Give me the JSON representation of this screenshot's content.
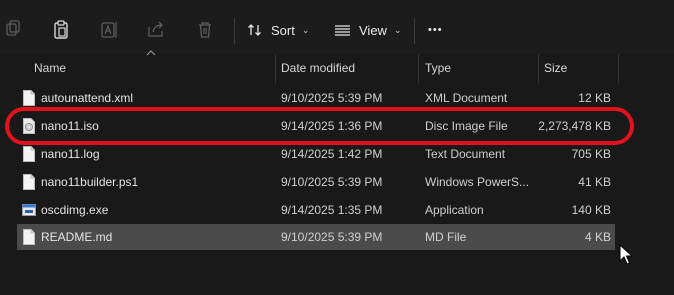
{
  "toolbar": {
    "sort_label": "Sort",
    "view_label": "View",
    "more_label": "•••"
  },
  "columns": {
    "name": "Name",
    "date": "Date modified",
    "type": "Type",
    "size": "Size"
  },
  "files": [
    {
      "name": "autounattend.xml",
      "date": "9/10/2025 5:39 PM",
      "type": "XML Document",
      "size": "12 KB",
      "icon": "xml-file-icon"
    },
    {
      "name": "nano11.iso",
      "date": "9/14/2025 1:36 PM",
      "type": "Disc Image File",
      "size": "2,273,478 KB",
      "icon": "disc-image-icon"
    },
    {
      "name": "nano11.log",
      "date": "9/14/2025 1:42 PM",
      "type": "Text Document",
      "size": "705 KB",
      "icon": "text-file-icon"
    },
    {
      "name": "nano11builder.ps1",
      "date": "9/10/2025 5:39 PM",
      "type": "Windows PowerS...",
      "size": "41 KB",
      "icon": "powershell-file-icon"
    },
    {
      "name": "oscdimg.exe",
      "date": "9/14/2025 1:35 PM",
      "type": "Application",
      "size": "140 KB",
      "icon": "application-icon"
    },
    {
      "name": "README.md",
      "date": "9/10/2025 5:39 PM",
      "type": "MD File",
      "size": "4 KB",
      "icon": "md-file-icon"
    }
  ],
  "selected_row": "README.md",
  "colors": {
    "highlight": "#e2111b",
    "selection": "#4b4b4b",
    "background": "#191919"
  }
}
